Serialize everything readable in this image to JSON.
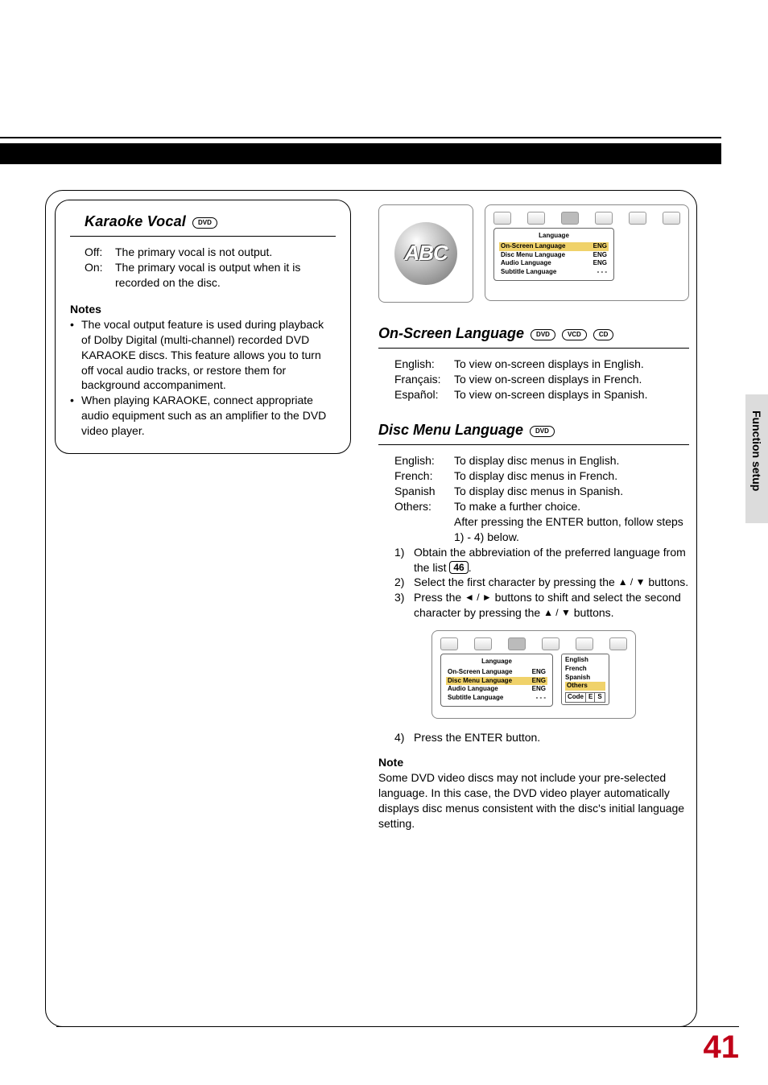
{
  "header": {
    "sideTab": "Function setup"
  },
  "pageNumber": "41",
  "left": {
    "title": "Karaoke Vocal",
    "badge": "DVD",
    "rows": [
      {
        "label": "Off:",
        "text": "The primary vocal is not output."
      },
      {
        "label": "On:",
        "text": "The primary vocal is output when it is recorded on the disc."
      }
    ],
    "notesHeading": "Notes",
    "notes": [
      "The vocal output feature is used during playback of Dolby Digital (multi-channel) recorded DVD KARAOKE discs. This feature allows you to turn off vocal audio tracks, or restore them for background accompaniment.",
      "When playing KARAOKE, connect appropriate audio equipment such as an amplifier to the DVD video player."
    ]
  },
  "abcBadge": "ABC",
  "osdTop": {
    "title": "Language",
    "rows": [
      {
        "k": "On-Screen Language",
        "v": "ENG",
        "hl": true
      },
      {
        "k": "Disc Menu Language",
        "v": "ENG",
        "hl": false
      },
      {
        "k": "Audio Language",
        "v": "ENG",
        "hl": false
      },
      {
        "k": "Subtitle Language",
        "v": "- - -",
        "hl": false
      }
    ]
  },
  "osl": {
    "title": "On-Screen Language",
    "badges": [
      "DVD",
      "VCD",
      "CD"
    ],
    "rows": [
      {
        "label": "English:",
        "text": "To view on-screen displays in English."
      },
      {
        "label": "Français:",
        "text": "To view on-screen displays in French."
      },
      {
        "label": "Español:",
        "text": "To view on-screen displays in Spanish."
      }
    ]
  },
  "dml": {
    "title": "Disc Menu Language",
    "badge": "DVD",
    "rows": [
      {
        "label": "English:",
        "text": "To display disc menus in English."
      },
      {
        "label": "French:",
        "text": "To display disc menus in French."
      },
      {
        "label": "Spanish",
        "text": "To display disc menus in Spanish."
      },
      {
        "label": "Others:",
        "text": "To make a further choice."
      }
    ],
    "othersCont": "After pressing the ENTER button, follow steps 1) - 4) below.",
    "steps": [
      {
        "n": "1)",
        "pre": "Obtain the abbreviation of the preferred language from the list ",
        "ref": "46",
        "post": "."
      },
      {
        "n": "2)",
        "pre": "Select the first character by pressing the ",
        "arrows": "▲ / ▼",
        "post": " buttons."
      },
      {
        "n": "3)",
        "pre": "Press the ",
        "arrows": "◄ / ►",
        "mid": " buttons to shift and select the second character by pressing the ",
        "arrows2": "▲ / ▼",
        "post": " buttons."
      }
    ],
    "step4": {
      "n": "4)",
      "text": "Press the ENTER button."
    },
    "noteHeading": "Note",
    "noteText": "Some DVD video discs may not include your pre-selected language. In this case, the DVD video player automatically displays disc menus consistent with the disc's initial language setting."
  },
  "osdMini": {
    "title": "Language",
    "rows": [
      {
        "k": "On-Screen Language",
        "v": "ENG",
        "hl": false
      },
      {
        "k": "Disc Menu Language",
        "v": "ENG",
        "hl": true
      },
      {
        "k": "Audio Language",
        "v": "ENG",
        "hl": false
      },
      {
        "k": "Subtitle Language",
        "v": "- - -",
        "hl": false
      }
    ],
    "popup": {
      "items": [
        "English",
        "French",
        "Spanish",
        "Others"
      ],
      "hlIndex": 3,
      "code": [
        "Code",
        "E",
        "S"
      ]
    }
  }
}
